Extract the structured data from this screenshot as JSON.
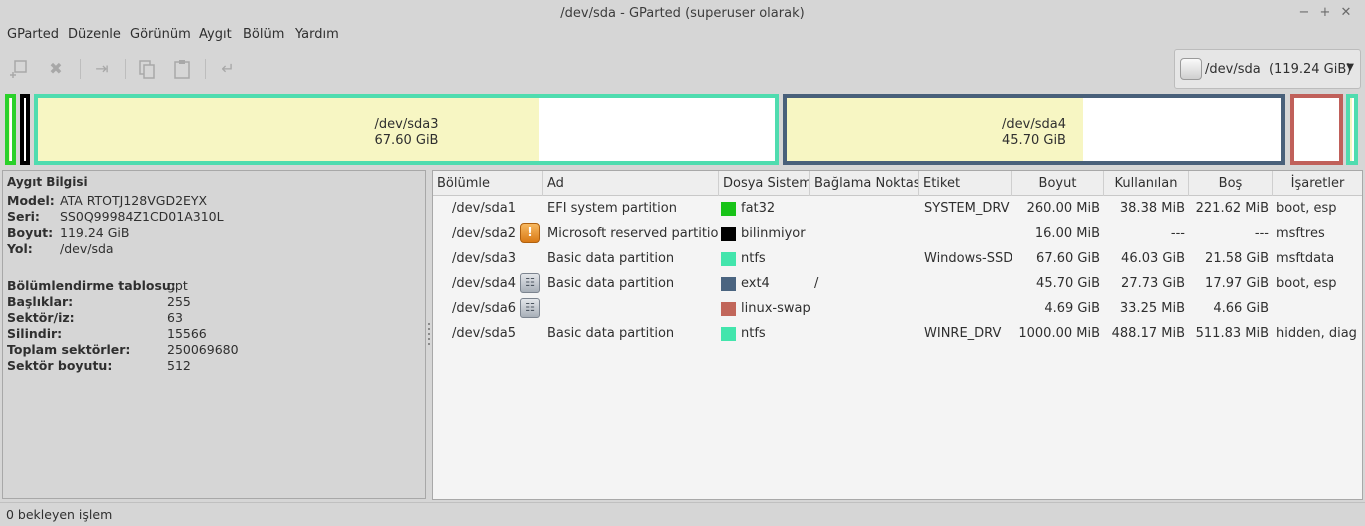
{
  "window": {
    "title": "/dev/sda - GParted (superuser olarak)"
  },
  "menu": [
    "GParted",
    "Düzenle",
    "Görünüm",
    "Aygıt",
    "Bölüm",
    "Yardım"
  ],
  "device_selector": {
    "label": "/dev/sda  (119.24 GiB)"
  },
  "graph": {
    "partitions": [
      {
        "id": "sda1",
        "border": "#2ad12a",
        "used_fraction": 0.15
      },
      {
        "id": "sda2",
        "border": "#000000",
        "used_fraction": 0
      },
      {
        "id": "sda3",
        "name": "/dev/sda3",
        "size": "67.60 GiB",
        "border": "#4fdcaf",
        "used_fraction": 0.68
      },
      {
        "id": "sda4",
        "name": "/dev/sda4",
        "size": "45.70 GiB",
        "border": "#49607a",
        "used_fraction": 0.6
      },
      {
        "id": "sda6",
        "border": "#c0605a",
        "used_fraction": 0
      },
      {
        "id": "sda5",
        "border": "#4fdcaf",
        "used_fraction": 0.49
      }
    ]
  },
  "device_info": {
    "title": "Aygıt Bilgisi",
    "rows_a": [
      {
        "key": "Model:",
        "value": "ATA RTOTJ128VGD2EYX"
      },
      {
        "key": "Seri:",
        "value": "SS0Q99984Z1CD01A310L"
      },
      {
        "key": "Boyut:",
        "value": "119.24 GiB"
      },
      {
        "key": "Yol:",
        "value": "/dev/sda"
      }
    ],
    "rows_b": [
      {
        "key": "Bölümlendirme tablosu:",
        "value": "gpt"
      },
      {
        "key": "Başlıklar:",
        "value": "255"
      },
      {
        "key": "Sektör/iz:",
        "value": "63"
      },
      {
        "key": "Silindir:",
        "value": "15566"
      },
      {
        "key": "Toplam sektörler:",
        "value": "250069680"
      },
      {
        "key": "Sektör boyutu:",
        "value": "512"
      }
    ]
  },
  "table": {
    "columns": [
      "Bölümle",
      "Ad",
      "Dosya Sistemi",
      "Bağlama Noktası",
      "Etiket",
      "Boyut",
      "Kullanılan",
      "Boş",
      "İşaretler"
    ],
    "rows": [
      {
        "partition": "/dev/sda1",
        "icon": "",
        "name": "EFI system partition",
        "fs": "fat32",
        "fs_color": "#18c318",
        "mount": "",
        "label": "SYSTEM_DRV",
        "size": "260.00 MiB",
        "used": "38.38 MiB",
        "free": "221.62 MiB",
        "flags": "boot, esp"
      },
      {
        "partition": "/dev/sda2",
        "icon": "warning-icon",
        "name": "Microsoft reserved partition",
        "fs": "bilinmiyor",
        "fs_color": "#000000",
        "mount": "",
        "label": "",
        "size": "16.00 MiB",
        "used": "---",
        "free": "---",
        "flags": "msftres"
      },
      {
        "partition": "/dev/sda3",
        "icon": "",
        "name": "Basic data partition",
        "fs": "ntfs",
        "fs_color": "#42e5ac",
        "mount": "",
        "label": "Windows-SSD",
        "size": "67.60 GiB",
        "used": "46.03 GiB",
        "free": "21.58 GiB",
        "flags": "msftdata"
      },
      {
        "partition": "/dev/sda4",
        "icon": "lock-icon",
        "name": "Basic data partition",
        "fs": "ext4",
        "fs_color": "#4a6480",
        "mount": "/",
        "label": "",
        "size": "45.70 GiB",
        "used": "27.73 GiB",
        "free": "17.97 GiB",
        "flags": "boot, esp"
      },
      {
        "partition": "/dev/sda6",
        "icon": "lock-icon",
        "name": "",
        "fs": "linux-swap",
        "fs_color": "#c1665a",
        "mount": "",
        "label": "",
        "size": "4.69 GiB",
        "used": "33.25 MiB",
        "free": "4.66 GiB",
        "flags": ""
      },
      {
        "partition": "/dev/sda5",
        "icon": "",
        "name": "Basic data partition",
        "fs": "ntfs",
        "fs_color": "#42e5ac",
        "mount": "",
        "label": "WINRE_DRV",
        "size": "1000.00 MiB",
        "used": "488.17 MiB",
        "free": "511.83 MiB",
        "flags": "hidden, diag"
      }
    ]
  },
  "status": {
    "text": "0 bekleyen işlem"
  }
}
